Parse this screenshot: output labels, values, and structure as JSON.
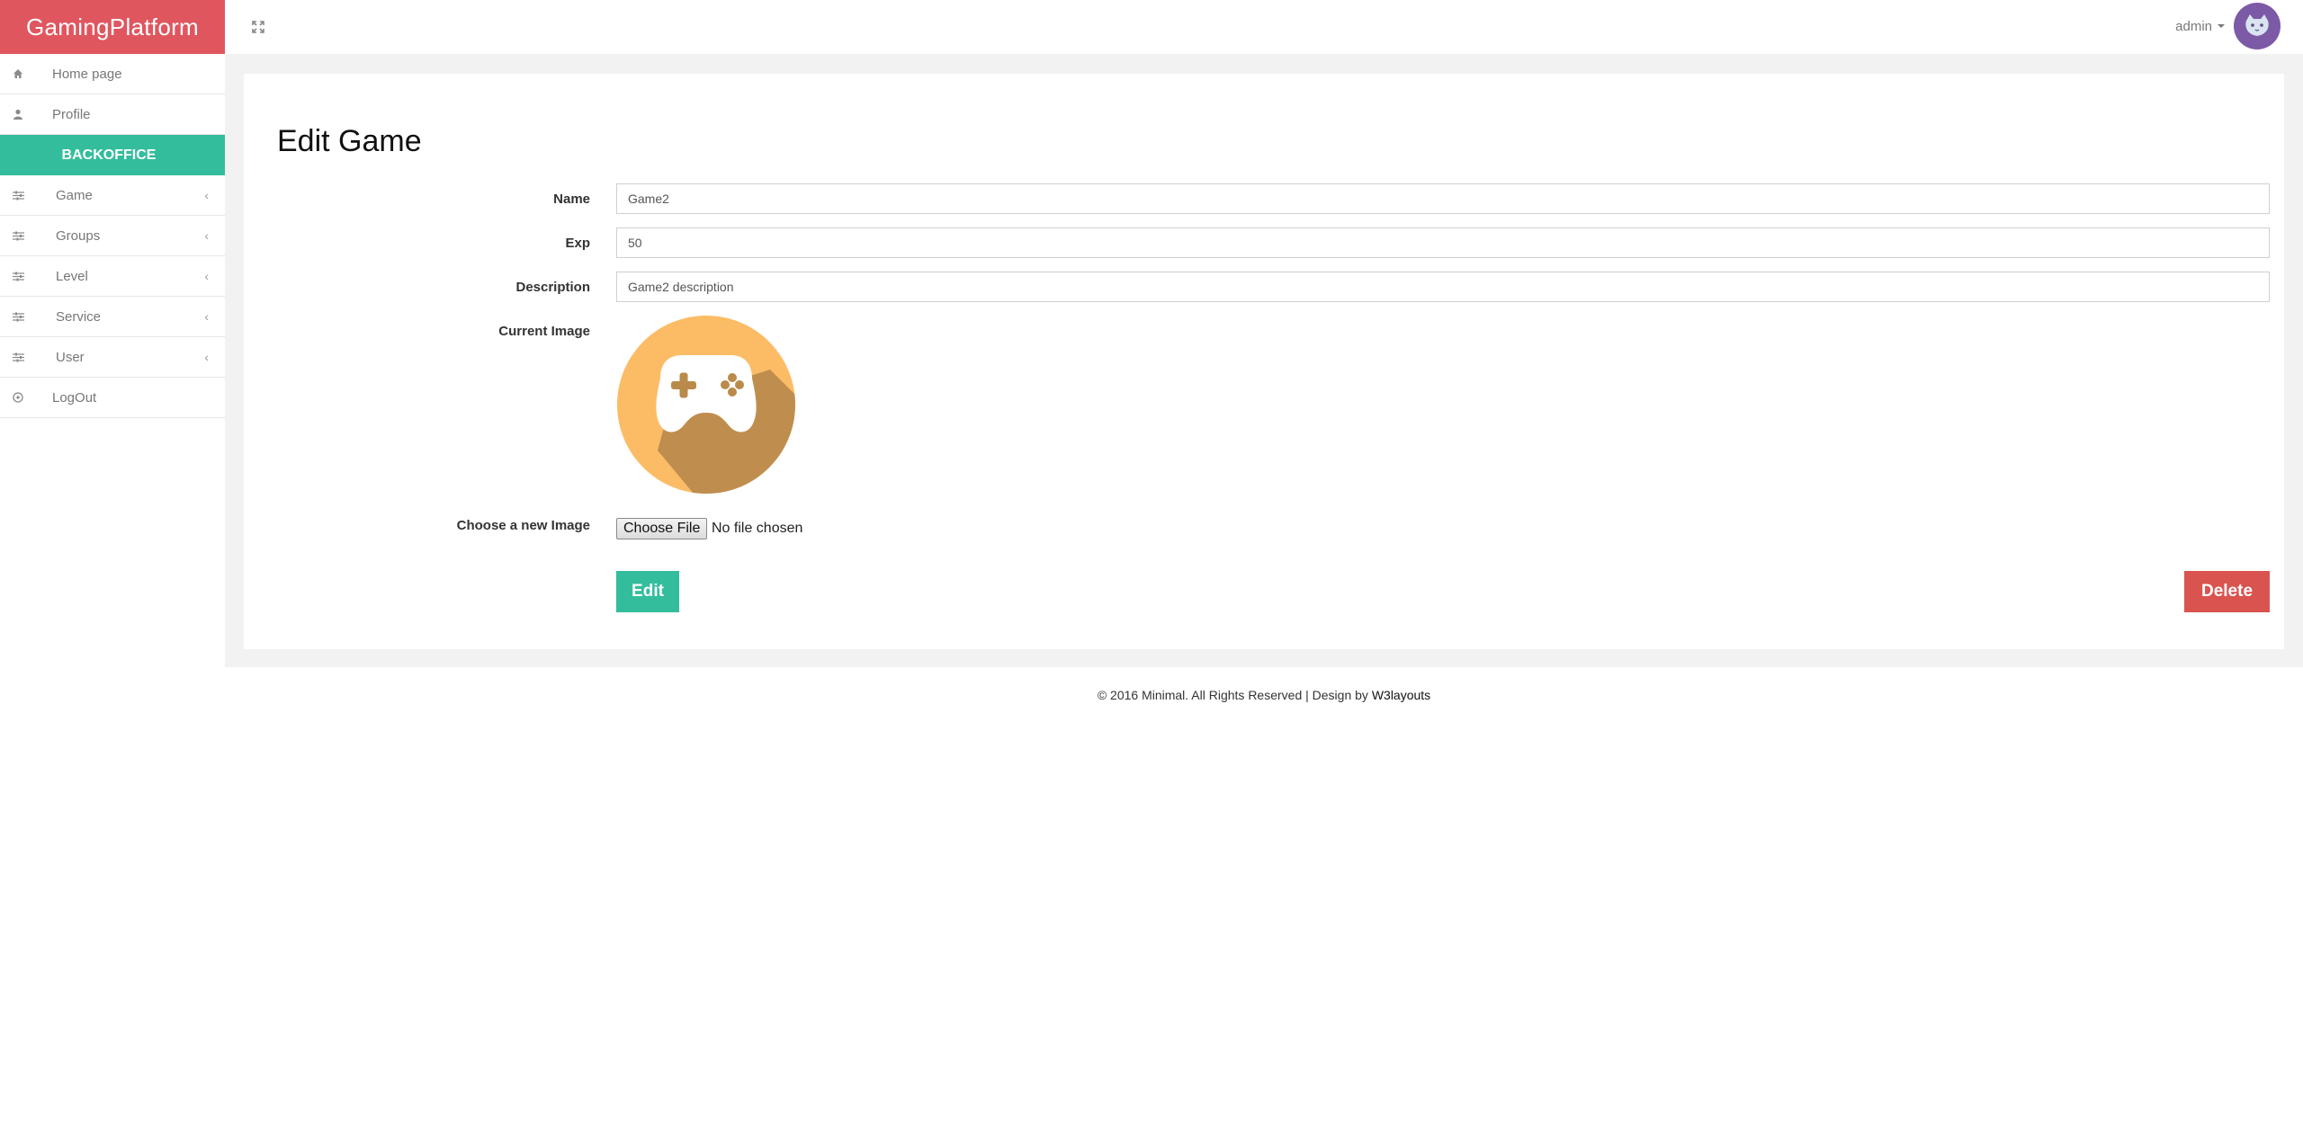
{
  "brand": "GamingPlatform",
  "sidebar": {
    "items": [
      {
        "label": "Home page",
        "icon": "home-icon"
      },
      {
        "label": "Profile",
        "icon": "user-icon"
      }
    ],
    "section_label": "BACKOFFICE",
    "submenus": [
      {
        "label": "Game",
        "icon": "sliders-icon"
      },
      {
        "label": "Groups",
        "icon": "sliders-icon"
      },
      {
        "label": "Level",
        "icon": "sliders-icon"
      },
      {
        "label": "Service",
        "icon": "sliders-icon"
      },
      {
        "label": "User",
        "icon": "sliders-icon"
      }
    ],
    "logout_label": "LogOut",
    "chevron": "‹"
  },
  "topbar": {
    "user_name": "admin",
    "expand_icon": "expand-icon"
  },
  "page": {
    "title": "Edit Game",
    "fields": {
      "name": {
        "label": "Name",
        "value": "Game2"
      },
      "exp": {
        "label": "Exp",
        "value": "50"
      },
      "description": {
        "label": "Description",
        "value": "Game2 description"
      },
      "current_image": {
        "label": "Current Image"
      },
      "new_image": {
        "label": "Choose a new Image",
        "button": "Choose File",
        "status": "No file chosen"
      }
    },
    "edit_button": "Edit",
    "delete_button": "Delete"
  },
  "footer": {
    "text": "© 2016 Minimal. All Rights Reserved | Design by ",
    "link": "W3layouts"
  },
  "colors": {
    "brand": "#e0565f",
    "accent": "#33bd9c",
    "danger": "#d9534f",
    "avatar": "#7c5aa6"
  }
}
